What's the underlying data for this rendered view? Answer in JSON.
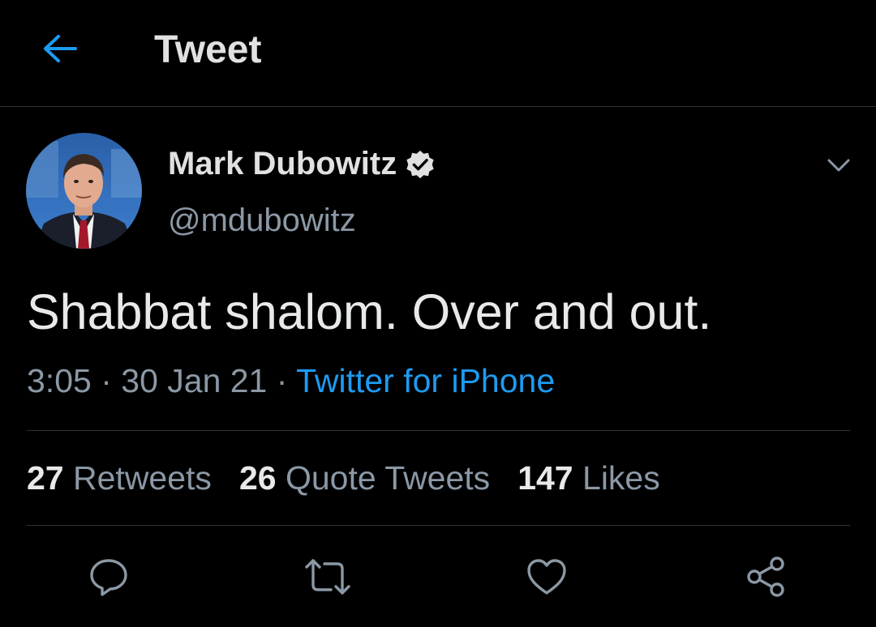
{
  "header": {
    "title": "Tweet",
    "back_icon": "arrow-left-icon"
  },
  "author": {
    "name": "Mark Dubowitz",
    "handle": "@mdubowitz",
    "verified": true
  },
  "tweet": {
    "text": "Shabbat shalom. Over and out.",
    "time": "3:05",
    "date": "30 Jan 21",
    "source": "Twitter for iPhone"
  },
  "stats": [
    {
      "count": "27",
      "label": "Retweets"
    },
    {
      "count": "26",
      "label": "Quote Tweets"
    },
    {
      "count": "147",
      "label": "Likes"
    }
  ],
  "actions": [
    "reply-icon",
    "retweet-icon",
    "like-icon",
    "share-icon"
  ],
  "colors": {
    "accent": "#1d9bf0",
    "background": "#000000",
    "muted": "#8b98a5",
    "divider": "#2f3336"
  }
}
